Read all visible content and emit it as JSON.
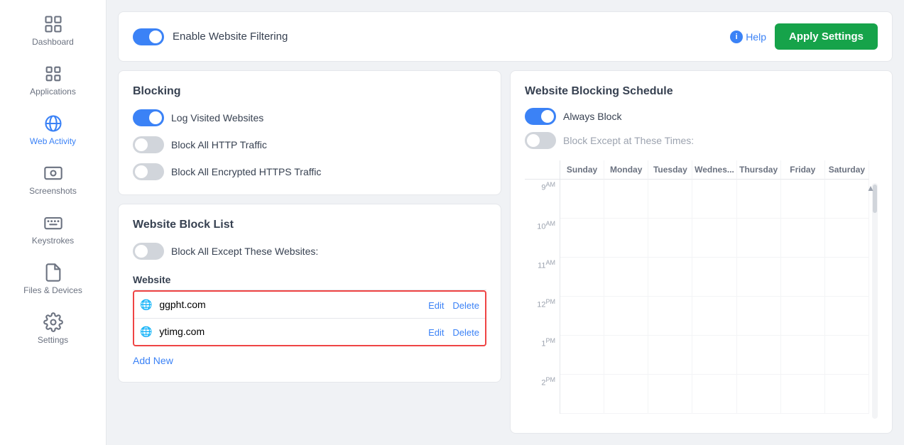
{
  "sidebar": {
    "items": [
      {
        "id": "dashboard",
        "label": "Dashboard",
        "icon": "dashboard"
      },
      {
        "id": "applications",
        "label": "Applications",
        "icon": "applications"
      },
      {
        "id": "web-activity",
        "label": "Web Activity",
        "icon": "web-activity",
        "active": true
      },
      {
        "id": "screenshots",
        "label": "Screenshots",
        "icon": "screenshots"
      },
      {
        "id": "keystrokes",
        "label": "Keystrokes",
        "icon": "keystrokes"
      },
      {
        "id": "files-devices",
        "label": "Files & Devices",
        "icon": "files-devices"
      },
      {
        "id": "settings",
        "label": "Settings",
        "icon": "settings"
      }
    ]
  },
  "header": {
    "toggle_label": "Enable Website Filtering",
    "help_label": "Help",
    "apply_label": "Apply Settings",
    "toggle_on": true
  },
  "blocking": {
    "title": "Blocking",
    "items": [
      {
        "id": "log-visited",
        "label": "Log Visited Websites",
        "enabled": true
      },
      {
        "id": "block-http",
        "label": "Block All HTTP Traffic",
        "enabled": false
      },
      {
        "id": "block-https",
        "label": "Block All Encrypted HTTPS Traffic",
        "enabled": false
      }
    ]
  },
  "block_list": {
    "title": "Website Block List",
    "except_label": "Block All Except These Websites:",
    "except_enabled": false,
    "col_header": "Website",
    "websites": [
      {
        "domain": "ggpht.com"
      },
      {
        "domain": "ytimg.com"
      }
    ],
    "edit_label": "Edit",
    "delete_label": "Delete",
    "add_new_label": "Add New"
  },
  "schedule": {
    "title": "Website Blocking Schedule",
    "always_block_label": "Always Block",
    "always_block_enabled": true,
    "except_times_label": "Block Except at These Times:",
    "except_times_enabled": false,
    "days": [
      "",
      "Sunday",
      "Monday",
      "Tuesday",
      "Wednes...",
      "Thursday",
      "Friday",
      "Saturday"
    ],
    "time_slots": [
      {
        "time": "9",
        "suffix": "AM"
      },
      {
        "time": "10",
        "suffix": "AM"
      },
      {
        "time": "11",
        "suffix": "AM"
      },
      {
        "time": "12",
        "suffix": "PM"
      },
      {
        "time": "1",
        "suffix": "PM"
      },
      {
        "time": "2",
        "suffix": "PM"
      }
    ]
  }
}
